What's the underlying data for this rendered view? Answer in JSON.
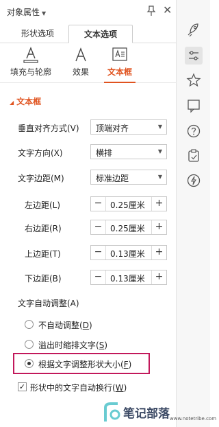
{
  "header": {
    "title": "对象属性",
    "close_glyph": "✕"
  },
  "tabs": [
    {
      "label": "形状选项",
      "active": false
    },
    {
      "label": "文本选项",
      "active": true
    }
  ],
  "subtabs": [
    {
      "label": "填充与轮廓",
      "icon": "text-fill-outline-icon",
      "active": false
    },
    {
      "label": "效果",
      "icon": "text-effect-icon",
      "active": false
    },
    {
      "label": "文本框",
      "icon": "textbox-icon",
      "active": true
    }
  ],
  "section": {
    "title": "文本框"
  },
  "form": {
    "valign": {
      "label": "垂直对齐方式(V)",
      "value": "顶端对齐"
    },
    "direction": {
      "label": "文字方向(X)",
      "value": "横排"
    },
    "margins": {
      "label": "文字边距(M)",
      "value": "标准边距"
    },
    "left": {
      "label": "左边距(L)",
      "value": "0.25厘米"
    },
    "right": {
      "label": "右边距(R)",
      "value": "0.25厘米"
    },
    "top": {
      "label": "上边距(T)",
      "value": "0.13厘米"
    },
    "bottom": {
      "label": "下边距(B)",
      "value": "0.13厘米"
    },
    "autofit_label": "文字自动调整(A)",
    "autofit_options": [
      {
        "text": "不自动调整(",
        "key": "D",
        "close": ")",
        "selected": false
      },
      {
        "text": "溢出时缩排文字(",
        "key": "S",
        "close": ")",
        "selected": false
      },
      {
        "text": "根据文字调整形状大小(",
        "key": "F",
        "close": ")",
        "selected": true
      }
    ],
    "wrap": {
      "text": "形状中的文字自动换行(",
      "key": "W",
      "close": ")",
      "checked": true
    }
  },
  "stepper": {
    "minus": "−",
    "plus": "+"
  },
  "rail_icons": [
    "rocket-icon",
    "property-sliders-icon",
    "star-pin-icon",
    "comment-icon",
    "help-icon",
    "clipboard-icon",
    "lightning-icon"
  ],
  "watermark": {
    "text": "笔记部落",
    "url": "www.notetribe.com"
  },
  "colors": {
    "accent": "#e0531f",
    "highlight": "#c2185b"
  }
}
